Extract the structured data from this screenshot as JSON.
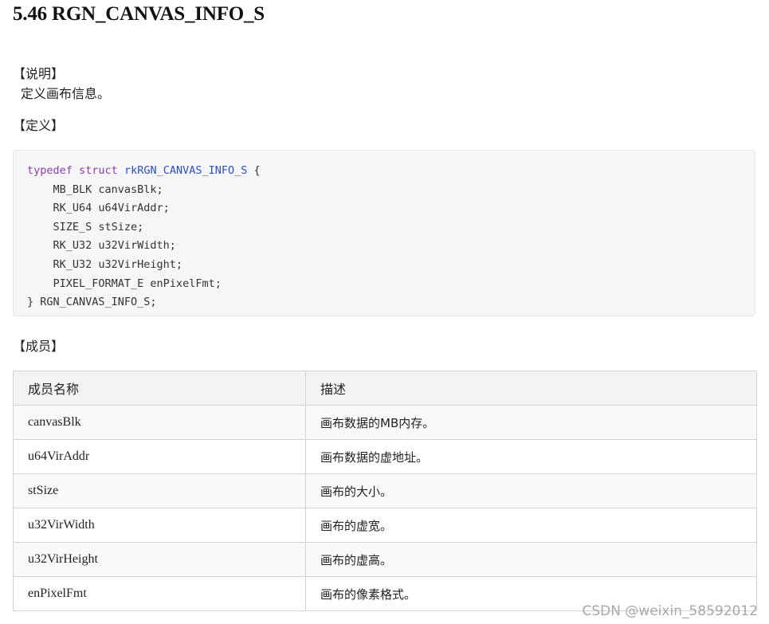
{
  "section": {
    "title": "5.46 RGN_CANVAS_INFO_S"
  },
  "description": {
    "label": "【说明】",
    "text": "定义画布信息。"
  },
  "definition": {
    "label": "【定义】",
    "code": {
      "line1_kw1": "typedef",
      "line1_kw2": "struct",
      "line1_name": "rkRGN_CANVAS_INFO_S",
      "line1_brace": " {",
      "fields": [
        "    MB_BLK canvasBlk;",
        "    RK_U64 u64VirAddr;",
        "    SIZE_S stSize;",
        "    RK_U32 u32VirWidth;",
        "    RK_U32 u32VirHeight;",
        "    PIXEL_FORMAT_E enPixelFmt;"
      ],
      "closing": "} RGN_CANVAS_INFO_S;"
    }
  },
  "members": {
    "label": "【成员】",
    "headers": {
      "name": "成员名称",
      "desc": "描述"
    },
    "rows": [
      {
        "name": "canvasBlk",
        "desc": "画布数据的MB内存。"
      },
      {
        "name": "u64VirAddr",
        "desc": "画布数据的虚地址。"
      },
      {
        "name": "stSize",
        "desc": "画布的大小。"
      },
      {
        "name": "u32VirWidth",
        "desc": "画布的虚宽。"
      },
      {
        "name": "u32VirHeight",
        "desc": "画布的虚高。"
      },
      {
        "name": "enPixelFmt",
        "desc": "画布的像素格式。"
      }
    ]
  },
  "watermark": "CSDN @weixin_58592012"
}
